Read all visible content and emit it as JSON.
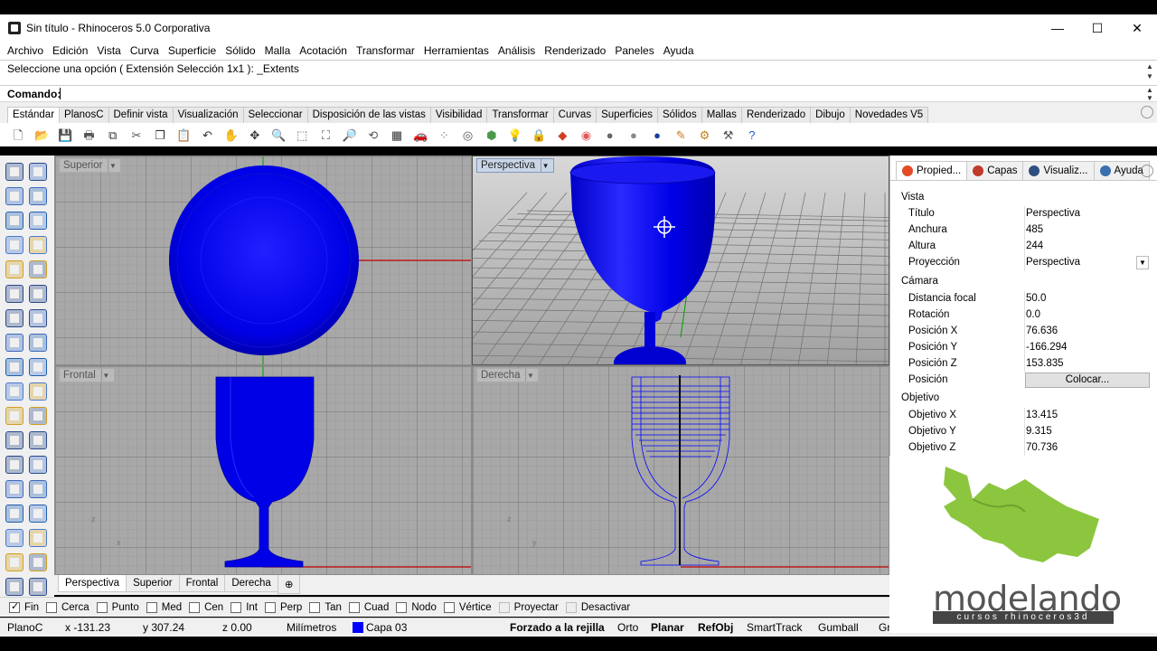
{
  "window": {
    "title": "Sin título - Rhinoceros  5.0 Corporativa",
    "minimize": "—",
    "maximize": "☐",
    "close": "✕"
  },
  "menu": [
    "Archivo",
    "Edición",
    "Vista",
    "Curva",
    "Superficie",
    "Sólido",
    "Malla",
    "Acotación",
    "Transformar",
    "Herramientas",
    "Análisis",
    "Renderizado",
    "Paneles",
    "Ayuda"
  ],
  "command": {
    "history": "Seleccione una opción ( Extensión  Selección  1x1 ): _Extents",
    "prompt_label": "Comando:",
    "prompt_value": ""
  },
  "toolbar_tabs": [
    "Estándar",
    "PlanosC",
    "Definir vista",
    "Visualización",
    "Seleccionar",
    "Disposición de las vistas",
    "Visibilidad",
    "Transformar",
    "Curvas",
    "Superficies",
    "Sólidos",
    "Mallas",
    "Renderizado",
    "Dibujo",
    "Novedades V5"
  ],
  "toolbar_icons": [
    {
      "name": "new-icon",
      "glyph": "🗋",
      "color": "#ffffff"
    },
    {
      "name": "open-icon",
      "glyph": "📂",
      "color": "#ffffff"
    },
    {
      "name": "save-icon",
      "glyph": "💾",
      "color": "#ffffff"
    },
    {
      "name": "print-icon",
      "glyph": "🖶",
      "color": "#ffffff"
    },
    {
      "name": "export-icon",
      "glyph": "⧉",
      "color": "#ffffff"
    },
    {
      "name": "cut-icon",
      "glyph": "✂",
      "color": "#ffffff"
    },
    {
      "name": "copy-icon",
      "glyph": "❐",
      "color": "#ffffff"
    },
    {
      "name": "paste-icon",
      "glyph": "📋",
      "color": "#ffffff"
    },
    {
      "name": "undo-icon",
      "glyph": "↶",
      "color": "#ffffff"
    },
    {
      "name": "pan-icon",
      "glyph": "✋",
      "color": "#ffffff"
    },
    {
      "name": "move-view-icon",
      "glyph": "✥",
      "color": "#ffffff"
    },
    {
      "name": "zoom-icon",
      "glyph": "🔍",
      "color": "#ffffff"
    },
    {
      "name": "zoom-window-icon",
      "glyph": "⬚",
      "color": "#ffffff"
    },
    {
      "name": "zoom-extents-icon",
      "glyph": "⛶",
      "color": "#ffffff"
    },
    {
      "name": "zoom-selected-icon",
      "glyph": "🔎",
      "color": "#ffffff"
    },
    {
      "name": "rotate-view-icon",
      "glyph": "⟲",
      "color": "#ffffff"
    },
    {
      "name": "viewport-layout-icon",
      "glyph": "▦",
      "color": "#ffffff"
    },
    {
      "name": "car-icon",
      "glyph": "🚗",
      "color": "#ffffff"
    },
    {
      "name": "points-icon",
      "glyph": "⁘",
      "color": "#ffffff"
    },
    {
      "name": "target-icon",
      "glyph": "◎",
      "color": "#ffffff"
    },
    {
      "name": "grid-points-icon",
      "glyph": "⬢",
      "color": "#ffffff"
    },
    {
      "name": "light-icon",
      "glyph": "💡",
      "color": "#ffffff"
    },
    {
      "name": "lock-icon",
      "glyph": "🔒",
      "color": "#ffffff"
    },
    {
      "name": "material-icon",
      "glyph": "◆",
      "color": "#ffffff"
    },
    {
      "name": "color-wheel-icon",
      "glyph": "◉",
      "color": "#ffffff"
    },
    {
      "name": "shaded-sphere-icon",
      "glyph": "●",
      "color": "#ffffff"
    },
    {
      "name": "rendered-sphere-icon",
      "glyph": "●",
      "color": "#ffffff"
    },
    {
      "name": "blue-sphere-icon",
      "glyph": "●",
      "color": "#ffffff"
    },
    {
      "name": "pen-icon",
      "glyph": "✎",
      "color": "#ffffff"
    },
    {
      "name": "settings-icon",
      "glyph": "⚙",
      "color": "#ffffff"
    },
    {
      "name": "tools-icon",
      "glyph": "⚒",
      "color": "#ffffff"
    },
    {
      "name": "help-icon",
      "glyph": "?",
      "color": "#ffffff"
    }
  ],
  "left_icons": [
    "select-arrow-icon",
    "point-icon",
    "polyline-icon",
    "curve-points-icon",
    "circle-icon",
    "circle-options-icon",
    "arc-icon",
    "rectangle-icon",
    "ellipse-icon",
    "fillet-icon",
    "curve-tools-icon",
    "surface-tools-icon",
    "box-icon",
    "sphere-icon",
    "extrude-icon",
    "boolean-icon",
    "gumball-icon",
    "mesh-icon",
    "move-icon",
    "scale-icon",
    "paint-icon",
    "settings-icon",
    "join-icon",
    "explode-icon",
    "text-icon",
    "dimension-icon",
    "transform-icon",
    "array-icon",
    "solid-tools-icon",
    "grid-icon",
    "point-array-icon",
    "group-icon",
    "edit-points-icon",
    "check-icon",
    "material-icon",
    "render-icon"
  ],
  "viewports": [
    {
      "label": "Superior",
      "active": false
    },
    {
      "label": "Perspectiva",
      "active": true
    },
    {
      "label": "Frontal",
      "active": false
    },
    {
      "label": "Derecha",
      "active": false
    }
  ],
  "viewport_tabs": [
    {
      "label": "Perspectiva",
      "active": true
    },
    {
      "label": "Superior",
      "active": false
    },
    {
      "label": "Frontal",
      "active": false
    },
    {
      "label": "Derecha",
      "active": false
    },
    {
      "label": "⊕",
      "active": false
    }
  ],
  "osnaps": [
    {
      "label": "Fin",
      "checked": true,
      "disabled": false
    },
    {
      "label": "Cerca",
      "checked": false,
      "disabled": false
    },
    {
      "label": "Punto",
      "checked": false,
      "disabled": false
    },
    {
      "label": "Med",
      "checked": false,
      "disabled": false
    },
    {
      "label": "Cen",
      "checked": false,
      "disabled": false
    },
    {
      "label": "Int",
      "checked": false,
      "disabled": false
    },
    {
      "label": "Perp",
      "checked": false,
      "disabled": false
    },
    {
      "label": "Tan",
      "checked": false,
      "disabled": false
    },
    {
      "label": "Cuad",
      "checked": false,
      "disabled": false
    },
    {
      "label": "Nodo",
      "checked": false,
      "disabled": false
    },
    {
      "label": "Vértice",
      "checked": false,
      "disabled": false
    },
    {
      "label": "Proyectar",
      "checked": false,
      "disabled": true
    },
    {
      "label": "Desactivar",
      "checked": false,
      "disabled": true
    }
  ],
  "status": {
    "cplane": "PlanoC",
    "x": "x -131.23",
    "y": "y 307.24",
    "z": "z 0.00",
    "units": "Milímetros",
    "layer": "Capa 03",
    "layer_color": "#0000ff",
    "grid_snap": "Forzado a la rejilla",
    "ortho": "Orto",
    "planar": "Planar",
    "osnap": "RefObj",
    "smarttrack": "SmartTrack",
    "gumball": "Gumball",
    "history": "Gr"
  },
  "panel": {
    "tabs": [
      {
        "label": "Propied...",
        "icon": "properties-icon",
        "color": "#e24b26"
      },
      {
        "label": "Capas",
        "icon": "layers-icon",
        "color": "#c0392b"
      },
      {
        "label": "Visualiz...",
        "icon": "display-icon",
        "color": "#2f4f7f"
      },
      {
        "label": "Ayuda",
        "icon": "help-icon",
        "color": "#3a6fb0"
      }
    ],
    "section_view": "Vista",
    "title_label": "Título",
    "title_value": "Perspectiva",
    "width_label": "Anchura",
    "width_value": "485",
    "height_label": "Altura",
    "height_value": "244",
    "projection_label": "Proyección",
    "projection_value": "Perspectiva",
    "section_camera": "Cámara",
    "focal_label": "Distancia focal",
    "focal_value": "50.0",
    "rotation_label": "Rotación",
    "rotation_value": "0.0",
    "posx_label": "Posición X",
    "posx_value": "76.636",
    "posy_label": "Posición Y",
    "posy_value": "-166.294",
    "posz_label": "Posición Z",
    "posz_value": "153.835",
    "pos_label": "Posición",
    "place_button": "Colocar...",
    "section_target": "Objetivo",
    "tx_label": "Objetivo X",
    "tx_value": "13.415",
    "ty_label": "Objetivo Y",
    "ty_value": "9.315",
    "tz_label": "Objetivo Z",
    "tz_value": "70.736"
  },
  "logo": {
    "wordmark": "modelando",
    "tagline": "cursos rhinoceros3d",
    "color": "#8cc63f"
  },
  "colors": {
    "object_blue": "#0000ff",
    "viewport_bg": "#a8a8a8",
    "grid_line": "#8e8e8e",
    "x_axis": "#c00000",
    "y_axis": "#00a000"
  }
}
